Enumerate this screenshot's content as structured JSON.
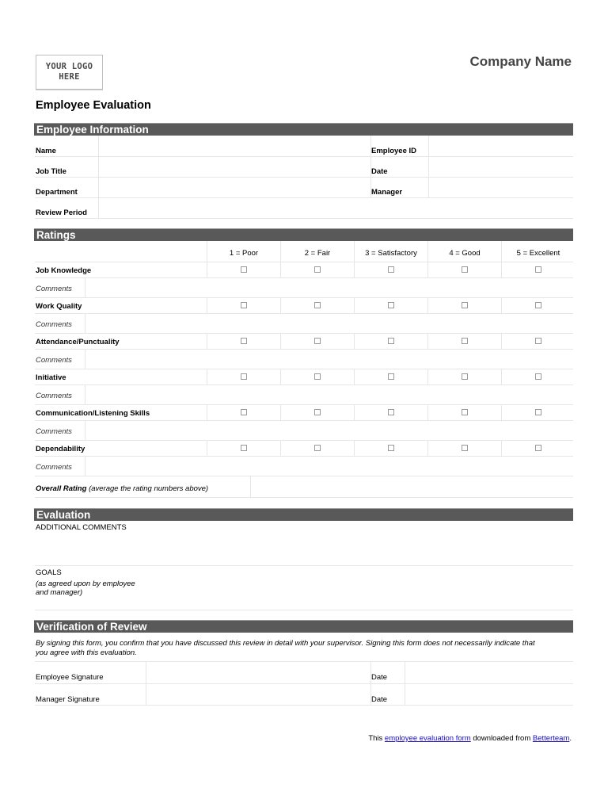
{
  "header": {
    "logo_line1": "YOUR LOGO",
    "logo_line2": "HERE",
    "company_name": "Company Name",
    "document_title": "Employee Evaluation"
  },
  "employee_information": {
    "title": "Employee Information",
    "fields": [
      {
        "label": "Name",
        "value": ""
      },
      {
        "label": "Job Title",
        "value": ""
      },
      {
        "label": "Department",
        "value": ""
      },
      {
        "label": "Review Period",
        "value": ""
      }
    ],
    "right_fields": [
      {
        "label": "Employee ID",
        "value": ""
      },
      {
        "label": "Date",
        "value": ""
      },
      {
        "label": "Manager",
        "value": ""
      }
    ]
  },
  "ratings": {
    "title": "Ratings",
    "scale": [
      "1 = Poor",
      "2 = Fair",
      "3 = Satisfactory",
      "4 = Good",
      "5 = Excellent"
    ],
    "comments_label": "Comments",
    "criteria": [
      {
        "label": "Job Knowledge",
        "checked": [
          false,
          false,
          false,
          false,
          false
        ],
        "comments": ""
      },
      {
        "label": "Work Quality",
        "checked": [
          false,
          false,
          false,
          false,
          false
        ],
        "comments": ""
      },
      {
        "label": "Attendance/Punctuality",
        "checked": [
          false,
          false,
          false,
          false,
          false
        ],
        "comments": ""
      },
      {
        "label": "Initiative",
        "checked": [
          false,
          false,
          false,
          false,
          false
        ],
        "comments": ""
      },
      {
        "label": "Communication/Listening Skills",
        "checked": [
          false,
          false,
          false,
          false,
          false
        ],
        "comments": ""
      },
      {
        "label": "Dependability",
        "checked": [
          false,
          false,
          false,
          false,
          false
        ],
        "comments": ""
      }
    ],
    "overall_label": "Overall Rating",
    "overall_hint": "(average the rating numbers above)",
    "overall_value": ""
  },
  "evaluation": {
    "title": "Evaluation",
    "additional_comments_label": "ADDITIONAL COMMENTS",
    "goals_label": "GOALS",
    "goals_hint_line1": "(as agreed upon by employee",
    "goals_hint_line2": "and manager)"
  },
  "verification": {
    "title": "Verification of Review",
    "notice_line1": "By signing this form, you confirm that you have discussed this review in detail with your supervisor. Signing this form does not necessarily indicate that",
    "notice_line2": "you agree with this evaluation.",
    "employee_signature_label": "Employee Signature",
    "manager_signature_label": "Manager Signature",
    "date_label": "Date"
  },
  "footer": {
    "prefix": "This ",
    "link1": "employee evaluation form",
    "middle": " downloaded from ",
    "link2": "Betterteam",
    "suffix": "."
  },
  "colors": {
    "section_bar": "#595959",
    "link": "#1a0dcc",
    "rule": "#e6e6e6"
  }
}
